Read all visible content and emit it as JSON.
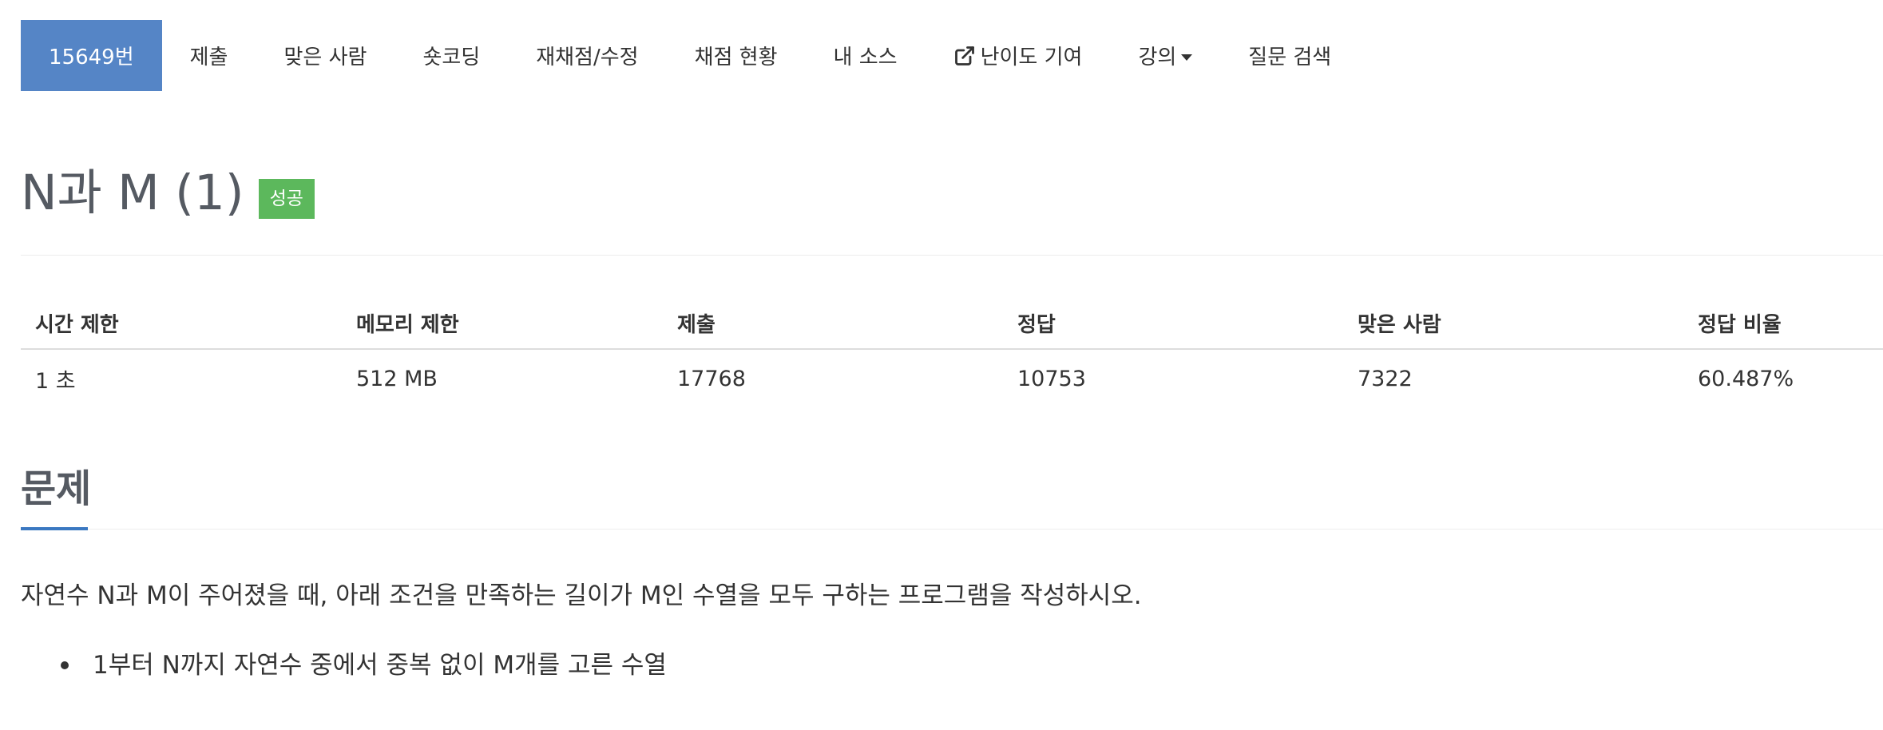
{
  "nav": {
    "problem_id_tab": "15649번",
    "items": [
      "제출",
      "맞은 사람",
      "숏코딩",
      "재채점/수정",
      "채점 현황",
      "내 소스",
      "난이도 기여",
      "강의",
      "질문 검색"
    ],
    "icons": {
      "difficulty": "external-link-icon",
      "lecture": "caret-down-icon"
    }
  },
  "problem": {
    "title": "N과 M (1)",
    "status": "성공"
  },
  "info_table": {
    "headers": [
      "시간 제한",
      "메모리 제한",
      "제출",
      "정답",
      "맞은 사람",
      "정답 비율"
    ],
    "values": [
      "1 초",
      "512 MB",
      "17768",
      "10753",
      "7322",
      "60.487%"
    ]
  },
  "section": {
    "title": "문제",
    "description": "자연수 N과 M이 주어졌을 때, 아래 조건을 만족하는 길이가 M인 수열을 모두 구하는 프로그램을 작성하시오.",
    "conditions": [
      "1부터 N까지 자연수 중에서 중복 없이 M개를 고른 수열"
    ]
  },
  "colors": {
    "active_tab": "#5585c6",
    "success_badge": "#5cb85c",
    "section_underline": "#3b78c1"
  }
}
